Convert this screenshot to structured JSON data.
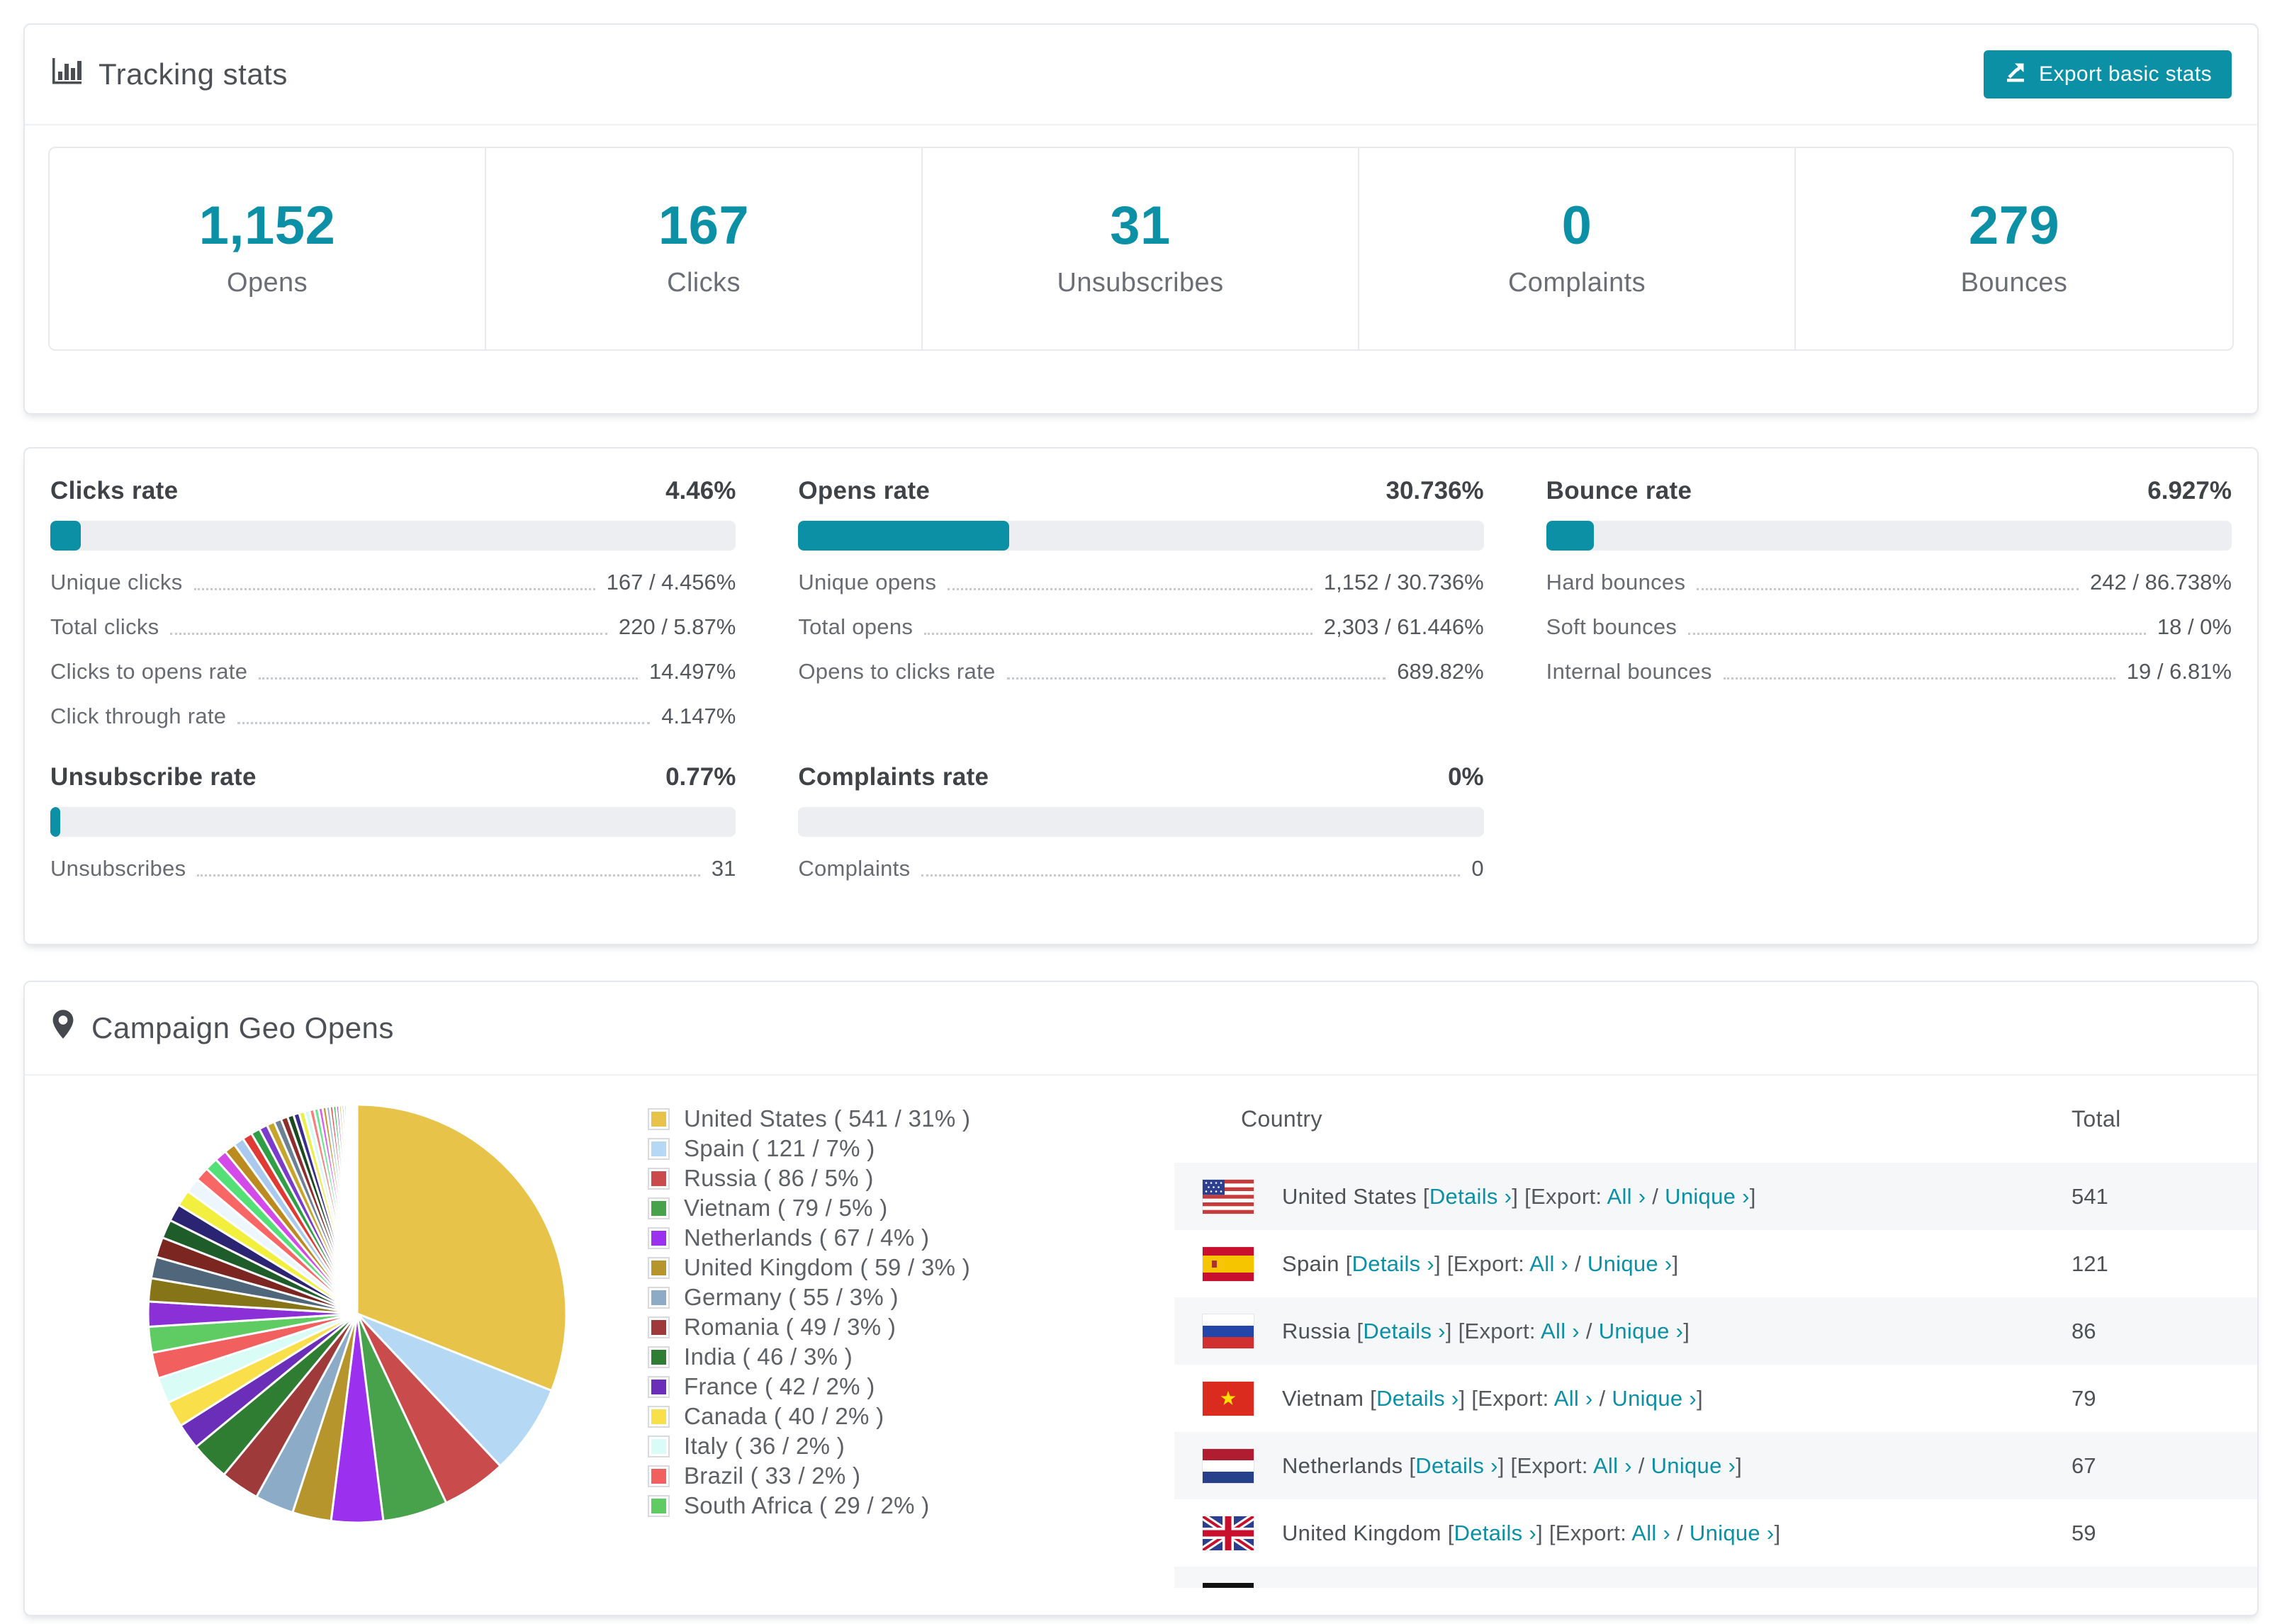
{
  "colors": {
    "accent": "#0b90a6",
    "track": "#eceef1",
    "row_stripe": "#f6f7f9"
  },
  "tracking": {
    "title": "Tracking stats",
    "export_button": "Export basic stats",
    "stats": [
      {
        "value": "1,152",
        "label": "Opens"
      },
      {
        "value": "167",
        "label": "Clicks"
      },
      {
        "value": "31",
        "label": "Unsubscribes"
      },
      {
        "value": "0",
        "label": "Complaints"
      },
      {
        "value": "279",
        "label": "Bounces"
      }
    ]
  },
  "rates": {
    "clicks": {
      "title": "Clicks rate",
      "value": "4.46%",
      "percent": 4.46,
      "rows": [
        {
          "label": "Unique clicks",
          "value": "167 / 4.456%"
        },
        {
          "label": "Total clicks",
          "value": "220 / 5.87%"
        },
        {
          "label": "Clicks to opens rate",
          "value": "14.497%"
        },
        {
          "label": "Click through rate",
          "value": "4.147%"
        }
      ]
    },
    "opens": {
      "title": "Opens rate",
      "value": "30.736%",
      "percent": 30.736,
      "rows": [
        {
          "label": "Unique opens",
          "value": "1,152 / 30.736%"
        },
        {
          "label": "Total opens",
          "value": "2,303 / 61.446%"
        },
        {
          "label": "Opens to clicks rate",
          "value": "689.82%"
        }
      ]
    },
    "bounce": {
      "title": "Bounce rate",
      "value": "6.927%",
      "percent": 6.927,
      "rows": [
        {
          "label": "Hard bounces",
          "value": "242 / 86.738%"
        },
        {
          "label": "Soft bounces",
          "value": "18 / 0%"
        },
        {
          "label": "Internal bounces",
          "value": "19 / 6.81%"
        }
      ]
    },
    "unsubscribe": {
      "title": "Unsubscribe rate",
      "value": "0.77%",
      "percent": 0.77,
      "rows": [
        {
          "label": "Unsubscribes",
          "value": "31"
        }
      ]
    },
    "complaints": {
      "title": "Complaints rate",
      "value": "0%",
      "percent": 0,
      "rows": [
        {
          "label": "Complaints",
          "value": "0"
        }
      ]
    }
  },
  "geo": {
    "title": "Campaign Geo Opens",
    "table": {
      "headers": [
        "Country",
        "Total"
      ],
      "labels": {
        "b1": " [",
        "details": "Details ›",
        "b2": "] [Export: ",
        "all": "All ›",
        "slash": " / ",
        "unique": "Unique ›",
        "b3": "]"
      },
      "rows": [
        {
          "name": "United States",
          "total": "541"
        },
        {
          "name": "Spain",
          "total": "121"
        },
        {
          "name": "Russia",
          "total": "86"
        },
        {
          "name": "Vietnam",
          "total": "79"
        },
        {
          "name": "Netherlands",
          "total": "67"
        },
        {
          "name": "United Kingdom",
          "total": "59"
        }
      ]
    }
  },
  "chart_data": {
    "type": "pie",
    "title": "Campaign Geo Opens",
    "unit": "opens",
    "legend_position": "right",
    "series": [
      {
        "name": "United States",
        "value": 541,
        "pct": 31,
        "color": "#e8c34a",
        "label": "United States ( 541 / 31% )"
      },
      {
        "name": "Spain",
        "value": 121,
        "pct": 7,
        "color": "#b5d9f4",
        "label": "Spain ( 121 / 7% )"
      },
      {
        "name": "Russia",
        "value": 86,
        "pct": 5,
        "color": "#c94b4b",
        "label": "Russia ( 86 / 5% )"
      },
      {
        "name": "Vietnam",
        "value": 79,
        "pct": 5,
        "color": "#47a24b",
        "label": "Vietnam ( 79 / 5% )"
      },
      {
        "name": "Netherlands",
        "value": 67,
        "pct": 4,
        "color": "#9b30ef",
        "label": "Netherlands ( 67 / 4% )"
      },
      {
        "name": "United Kingdom",
        "value": 59,
        "pct": 3,
        "color": "#b6952d",
        "label": "United Kingdom ( 59 / 3% )"
      },
      {
        "name": "Germany",
        "value": 55,
        "pct": 3,
        "color": "#8cabc7",
        "label": "Germany ( 55 / 3% )"
      },
      {
        "name": "Romania",
        "value": 49,
        "pct": 3,
        "color": "#9e3a3a",
        "label": "Romania ( 49 / 3% )"
      },
      {
        "name": "India",
        "value": 46,
        "pct": 3,
        "color": "#2e7d33",
        "label": "India ( 46 / 3% )"
      },
      {
        "name": "France",
        "value": 42,
        "pct": 2,
        "color": "#6a2eb8",
        "label": "France ( 42 / 2% )"
      },
      {
        "name": "Canada",
        "value": 40,
        "pct": 2,
        "color": "#f9e04b",
        "label": "Canada ( 40 / 2% )"
      },
      {
        "name": "Italy",
        "value": 36,
        "pct": 2,
        "color": "#dafcf6",
        "label": "Italy ( 36 / 2% )"
      },
      {
        "name": "Brazil",
        "value": 33,
        "pct": 2,
        "color": "#f25f5f",
        "label": "Brazil ( 33 / 2% )"
      },
      {
        "name": "South Africa",
        "value": 29,
        "pct": 2,
        "color": "#5fcb63",
        "label": "South Africa ( 29 / 2% )"
      }
    ],
    "others": {
      "approx_total_pct": 26,
      "note": "many small unlabeled country slices completing the circle",
      "colors": [
        "#8b2fd6",
        "#857518",
        "#50677b",
        "#7c2622",
        "#1e5c2a",
        "#2b2472",
        "#f2ef3e",
        "#eef6fd",
        "#f96666",
        "#55e077",
        "#d24ae8",
        "#bb8a20",
        "#a9c9ee",
        "#e03a34",
        "#2f9e44",
        "#7b3ccc",
        "#c7a52c",
        "#6d8195",
        "#8d2d2d",
        "#1c491f",
        "#3b2d8d",
        "#eded49",
        "#d6fbf5",
        "#f97f7f",
        "#69e58b",
        "#dc59ee",
        "#c59430",
        "#8fb3d8",
        "#e64646",
        "#36b24e",
        "#9452da",
        "#d3b73a",
        "#7fa0b6",
        "#9e3e3e",
        "#2a6231",
        "#483aa0",
        "#f2f26e",
        "#fbe7e9",
        "#f99595",
        "#86eda0"
      ]
    }
  }
}
